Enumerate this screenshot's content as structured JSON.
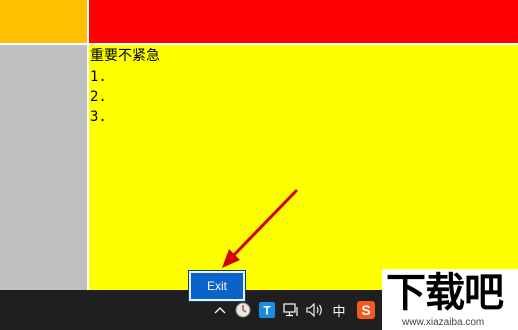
{
  "note": {
    "title": "重要不紧急",
    "items": [
      "1.",
      "2.",
      "3."
    ]
  },
  "colors": {
    "top_left": "#ffc000",
    "top_right": "#ff0000",
    "left_column": "#c0c0c0",
    "main_panel": "#ffff00",
    "taskbar": "#1f1f1f",
    "exit_button": "#0a63c9",
    "arrow": "#d40000"
  },
  "exit_button": {
    "label": "Exit"
  },
  "tray": {
    "icons": [
      "chevron-up-icon",
      "update-icon",
      "t-app-icon",
      "network-icon",
      "volume-icon",
      "ime-icon",
      "sogou-icon"
    ],
    "ime_label": "中",
    "sogou_label": "S"
  },
  "watermark": {
    "text": "下载吧",
    "url": "www.xiazaiba.com"
  }
}
